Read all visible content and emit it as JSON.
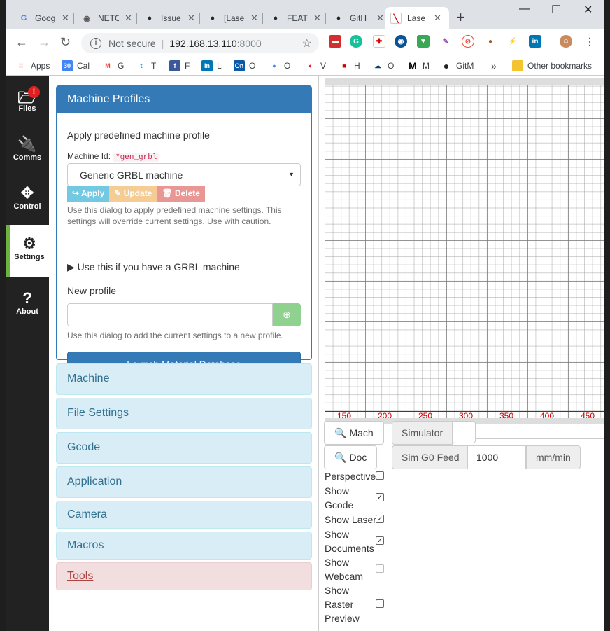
{
  "browser": {
    "tabs": [
      {
        "title": "Goog",
        "icon": "google-icon",
        "glyph": "G"
      },
      {
        "title": "NETC",
        "icon": "globe-icon",
        "glyph": "◉"
      },
      {
        "title": "Issue",
        "icon": "github-icon",
        "glyph": "●"
      },
      {
        "title": "[Lase",
        "icon": "github-icon",
        "glyph": "●"
      },
      {
        "title": "FEAT",
        "icon": "github-icon",
        "glyph": "●"
      },
      {
        "title": "GitH",
        "icon": "github-icon",
        "glyph": "●"
      },
      {
        "title": "Lase",
        "icon": "laserweb-icon",
        "glyph": "╲"
      }
    ],
    "window_controls": {
      "minimize": "—",
      "maximize": "☐",
      "close": "✕"
    },
    "address": {
      "security": "Not secure",
      "host": "192.168.13.110",
      "port": ":8000"
    },
    "bookmarks": [
      {
        "label": "Apps",
        "icon": "apps-icon",
        "color": "#e94235",
        "glyph": "⁞⁞"
      },
      {
        "label": "Cal",
        "icon": "calendar-icon",
        "color": "#4285f4",
        "glyph": "30"
      },
      {
        "label": "G",
        "icon": "gmail-icon",
        "color": "#ea4335",
        "glyph": "M"
      },
      {
        "label": "T",
        "icon": "twitter-icon",
        "color": "#1da1f2",
        "glyph": "t"
      },
      {
        "label": "F",
        "icon": "facebook-icon",
        "color": "#3b5998",
        "glyph": "f"
      },
      {
        "label": "L",
        "icon": "linkedin-icon",
        "color": "#0077b5",
        "glyph": "in"
      },
      {
        "label": "O",
        "icon": "onenote-icon",
        "color": "#0a5aa8",
        "glyph": "On"
      },
      {
        "label": "O",
        "icon": "circle-icon",
        "color": "#4285f4",
        "glyph": "●"
      },
      {
        "label": "V",
        "icon": "vodafone-icon",
        "color": "#e60000",
        "glyph": "◐"
      },
      {
        "label": "H",
        "icon": "h-icon",
        "color": "#c00",
        "glyph": "■"
      },
      {
        "label": "O",
        "icon": "cloud-icon",
        "color": "#0a3c78",
        "glyph": "☁"
      },
      {
        "label": "M",
        "icon": "m-icon",
        "color": "#000",
        "glyph": "M"
      },
      {
        "label": "GitM",
        "icon": "github-icon",
        "color": "#222",
        "glyph": "●"
      }
    ],
    "more_bookmarks": "»",
    "other_bookmarks": "Other bookmarks"
  },
  "sidebar": {
    "items": [
      {
        "label": "Files",
        "icon": "files-icon",
        "glyph": "🗁",
        "badge": "!"
      },
      {
        "label": "Comms",
        "icon": "plug-icon",
        "glyph": "🔌"
      },
      {
        "label": "Control",
        "icon": "arrows-icon",
        "glyph": "✥"
      },
      {
        "label": "Settings",
        "icon": "gears-icon",
        "glyph": "⚙"
      },
      {
        "label": "About",
        "icon": "question-icon",
        "glyph": "?"
      }
    ]
  },
  "profiles": {
    "title": "Machine Profiles",
    "subtitle": "Apply predefined machine profile",
    "machine_id_label": "Machine Id:",
    "machine_id": "*gen_grbl",
    "selected": "Generic GRBL machine",
    "apply": "Apply",
    "update": "Update",
    "delete": "Delete",
    "apply_help": "Use this dialog to apply predefined machine settings. This settings will override current settings. Use with caution.",
    "grbl_toggle": "Use this if you have a GRBL machine",
    "new_profile_label": "New profile",
    "new_profile_value": "",
    "add_help": "Use this dialog to add the current settings to a new profile.",
    "launch": "Launch Material Database"
  },
  "sections": [
    "Machine",
    "File Settings",
    "Gcode",
    "Application",
    "Camera",
    "Macros"
  ],
  "tools": "Tools",
  "workspace": {
    "ticks": [
      "150",
      "200",
      "250",
      "300",
      "350",
      "400",
      "450"
    ],
    "mach": "Mach",
    "doc": "Doc",
    "simulator": "Simulator",
    "sim_feed_label": "Sim G0 Feed",
    "sim_feed_value": "1000",
    "sim_feed_unit": "mm/min",
    "options": [
      {
        "label": "Perspective",
        "checked": false,
        "disabled": false
      },
      {
        "label": "Show Gcode",
        "checked": true,
        "disabled": false
      },
      {
        "label": "Show Laser",
        "checked": true,
        "disabled": false
      },
      {
        "label": "Show Documents",
        "checked": true,
        "disabled": false
      },
      {
        "label": "Show Webcam",
        "checked": false,
        "disabled": true
      },
      {
        "label": "Show Raster Preview",
        "checked": false,
        "disabled": false
      }
    ]
  }
}
